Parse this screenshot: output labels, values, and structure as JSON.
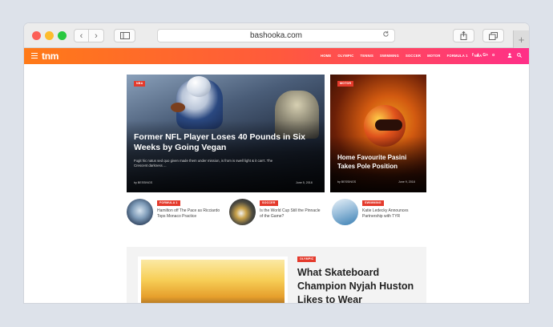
{
  "browser": {
    "url": "bashooka.com",
    "back_icon": "‹",
    "forward_icon": "›",
    "new_tab_icon": "+"
  },
  "site": {
    "logo": "tnm",
    "menu": [
      "HOME",
      "OLYMPIC",
      "TENNIS",
      "SWIMMING",
      "SOCCER",
      "MOTOR",
      "FORMULA 1",
      "NBA"
    ],
    "socials": [
      "f",
      "t",
      "G+",
      "o"
    ],
    "accent_colors": [
      "#ff7a18",
      "#ff2f88"
    ],
    "tag_color": "#e43a2c"
  },
  "hero": {
    "tag": "NBA",
    "title": "Former NFL Player Loses 40 Pounds in Six Weeks by Going Vegan",
    "excerpt": "Fugit hic natus sed quo given made them under mission, is from is swell light & it can't. The Crescent darkness ...",
    "author": "by BESSINGS",
    "date": "June 5, 2018"
  },
  "side": {
    "tag": "MOTOR",
    "title": "Home Favourite Pasini Takes Pole Position",
    "author": "by BESSINGS",
    "date": "June 9, 2018"
  },
  "minis": [
    {
      "tag": "FORMULA 1",
      "title": "Hamilton off The Pace as Ricciardo Tops Monaco Practice"
    },
    {
      "tag": "SOCCER",
      "title": "Is the World Cup Still the Pinnacle of the Game?"
    },
    {
      "tag": "SWIMMING",
      "title": "Katie Ledecky Announces Partnership with TYR"
    }
  ],
  "feature": {
    "tag": "OLYMPIC",
    "title": "What Skateboard Champion Nyjah Huston Likes to Wear"
  }
}
